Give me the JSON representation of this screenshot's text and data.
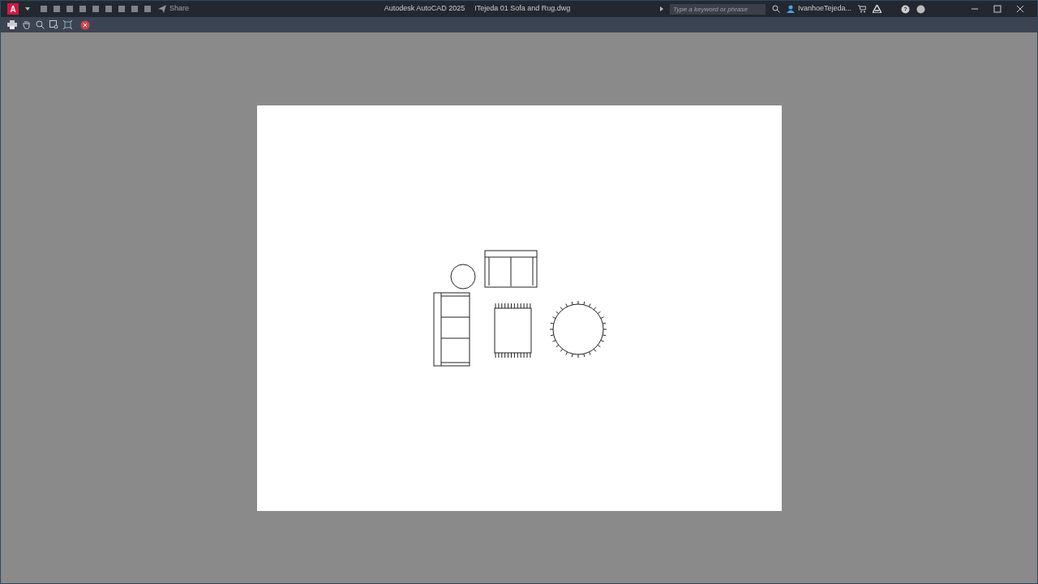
{
  "title_bar": {
    "logo": "A",
    "share": "Share",
    "app_name": "Autodesk AutoCAD 2025",
    "file_name": "ITejeda 01 Sofa and Rug.dwg",
    "search": {
      "placeholder": "Type a keyword or phrase"
    },
    "user": "IvanhoeTejeda..."
  }
}
